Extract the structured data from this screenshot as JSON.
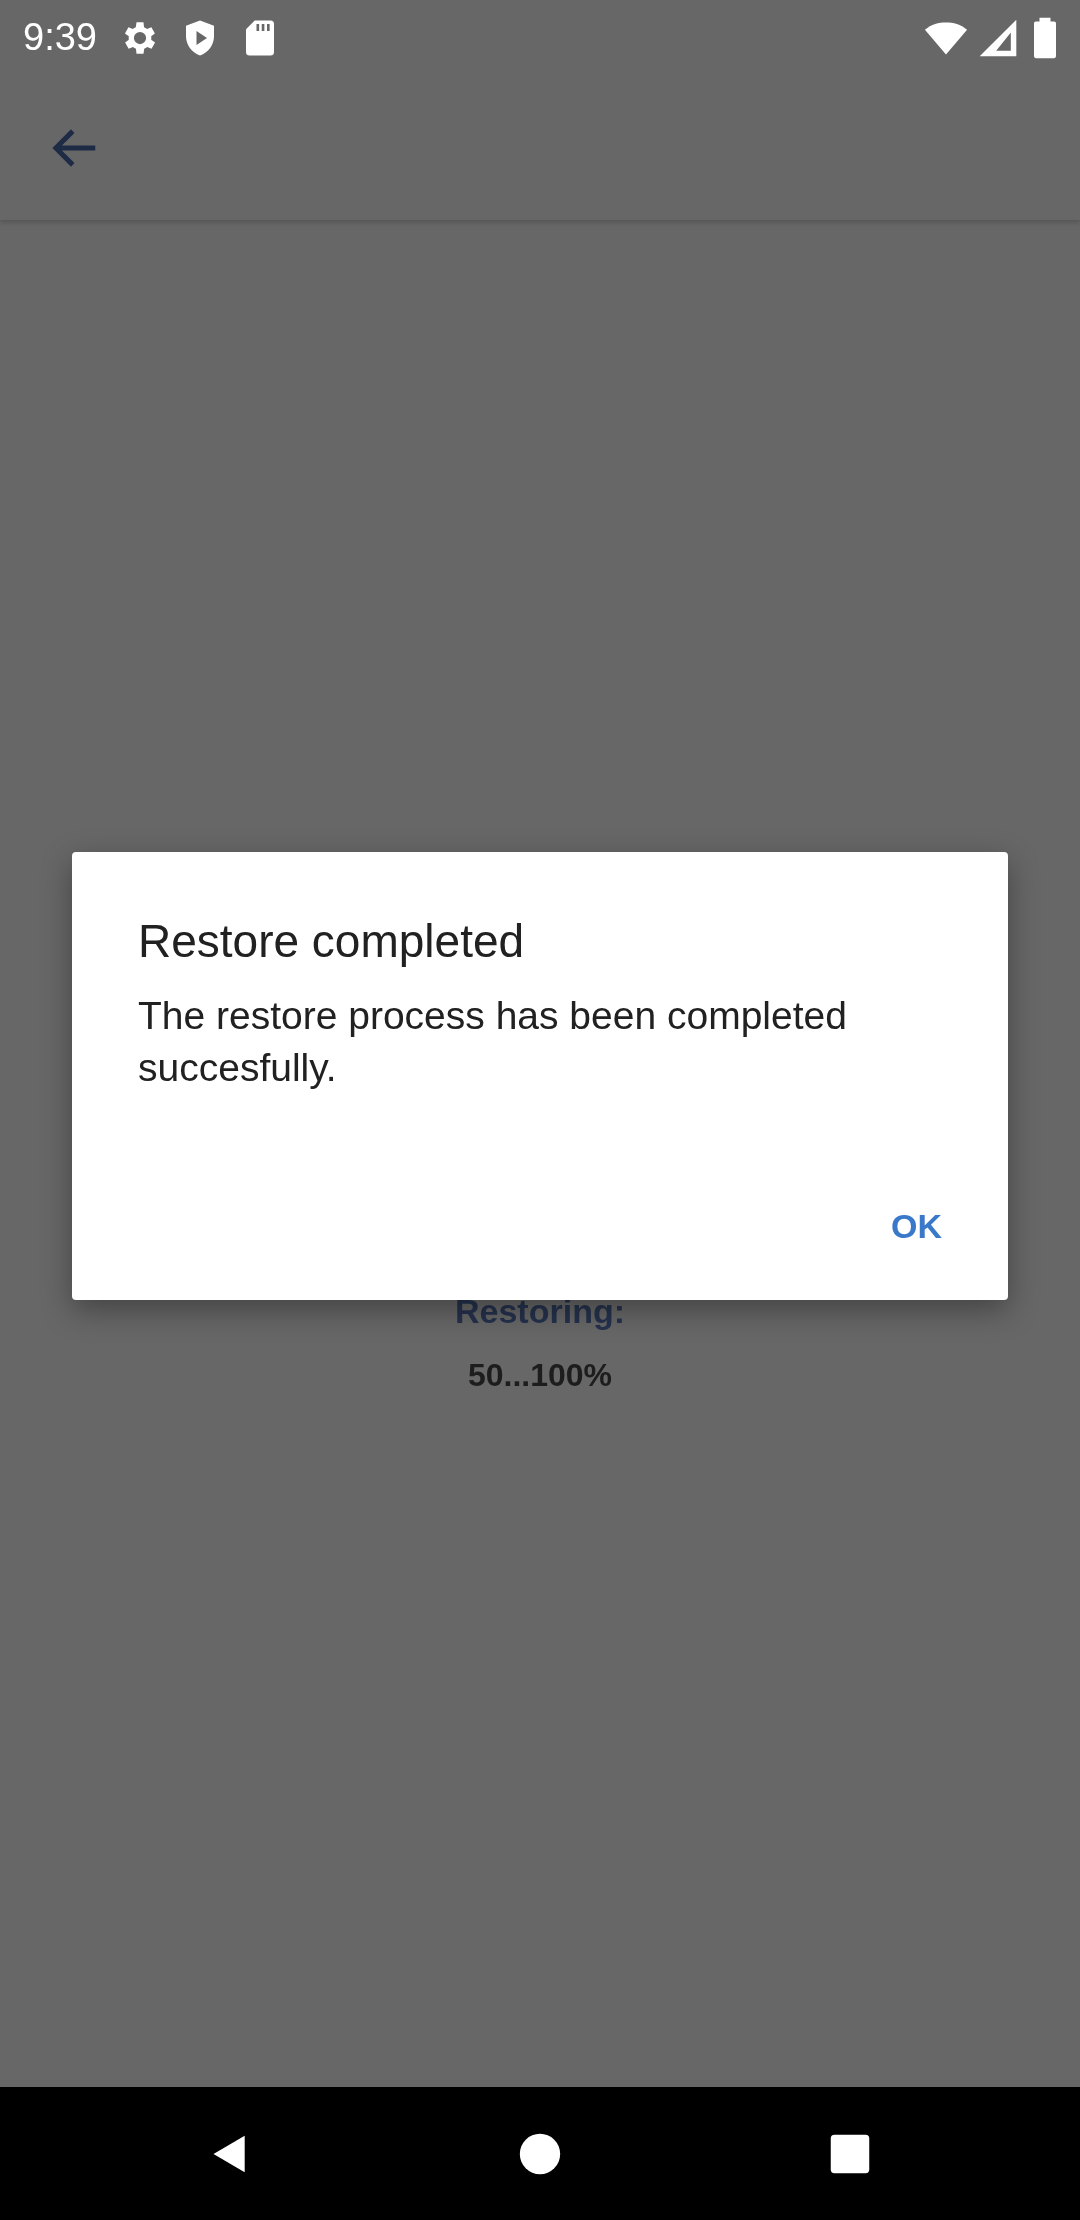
{
  "status_bar": {
    "time": "9:39"
  },
  "progress": {
    "label": "Restoring:",
    "value": "50...100%"
  },
  "dialog": {
    "title": "Restore completed",
    "message": "The restore process has been completed succesfully.",
    "buttons": [
      "OK"
    ]
  }
}
